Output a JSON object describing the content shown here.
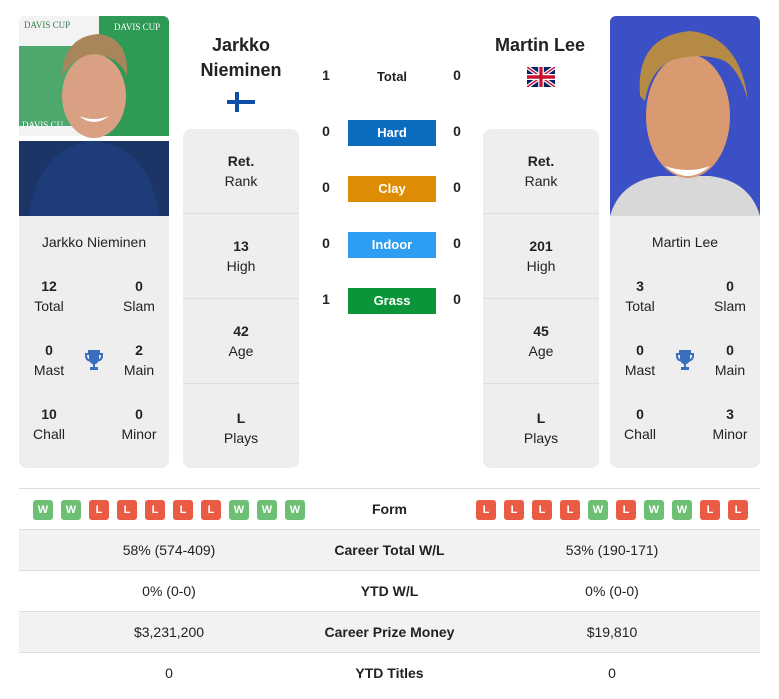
{
  "colors": {
    "hard": "#0a6bbf",
    "clay": "#de8c05",
    "indoor": "#2d9ef2",
    "grass": "#0c9438",
    "win": "#6cbf73",
    "loss": "#ea5b44",
    "trophy": "#3a6fbf"
  },
  "player1": {
    "name_line1": "Jarkko",
    "name_line2": "Nieminen",
    "full_name": "Jarkko Nieminen",
    "flag": "finland-flag",
    "titles": {
      "total": {
        "value": "12",
        "label": "Total"
      },
      "slam": {
        "value": "0",
        "label": "Slam"
      },
      "mast": {
        "value": "0",
        "label": "Mast"
      },
      "main": {
        "value": "2",
        "label": "Main"
      },
      "chall": {
        "value": "10",
        "label": "Chall"
      },
      "minor": {
        "value": "0",
        "label": "Minor"
      }
    },
    "info": {
      "rank": {
        "value": "Ret.",
        "label": "Rank"
      },
      "high": {
        "value": "13",
        "label": "High"
      },
      "age": {
        "value": "42",
        "label": "Age"
      },
      "plays": {
        "value": "L",
        "label": "Plays"
      }
    },
    "form": [
      "W",
      "W",
      "L",
      "L",
      "L",
      "L",
      "L",
      "W",
      "W",
      "W"
    ],
    "career_wl": "58% (574-409)",
    "ytd_wl": "0% (0-0)",
    "prize_money": "$3,231,200",
    "ytd_titles": "0"
  },
  "player2": {
    "name": "Martin Lee",
    "full_name": "Martin Lee",
    "flag": "united-kingdom-flag",
    "titles": {
      "total": {
        "value": "3",
        "label": "Total"
      },
      "slam": {
        "value": "0",
        "label": "Slam"
      },
      "mast": {
        "value": "0",
        "label": "Mast"
      },
      "main": {
        "value": "0",
        "label": "Main"
      },
      "chall": {
        "value": "0",
        "label": "Chall"
      },
      "minor": {
        "value": "3",
        "label": "Minor"
      }
    },
    "info": {
      "rank": {
        "value": "Ret.",
        "label": "Rank"
      },
      "high": {
        "value": "201",
        "label": "High"
      },
      "age": {
        "value": "45",
        "label": "Age"
      },
      "plays": {
        "value": "L",
        "label": "Plays"
      }
    },
    "form": [
      "L",
      "L",
      "L",
      "L",
      "W",
      "L",
      "W",
      "W",
      "L",
      "L"
    ],
    "career_wl": "53% (190-171)",
    "ytd_wl": "0% (0-0)",
    "prize_money": "$19,810",
    "ytd_titles": "0"
  },
  "h2h": {
    "total": {
      "label": "Total",
      "p1": "1",
      "p2": "0"
    },
    "hard": {
      "label": "Hard",
      "p1": "0",
      "p2": "0"
    },
    "clay": {
      "label": "Clay",
      "p1": "0",
      "p2": "0"
    },
    "indoor": {
      "label": "Indoor",
      "p1": "0",
      "p2": "0"
    },
    "grass": {
      "label": "Grass",
      "p1": "1",
      "p2": "0"
    }
  },
  "table": {
    "form_label": "Form",
    "career_wl_label": "Career Total W/L",
    "ytd_wl_label": "YTD W/L",
    "prize_label": "Career Prize Money",
    "ytd_titles_label": "YTD Titles"
  }
}
